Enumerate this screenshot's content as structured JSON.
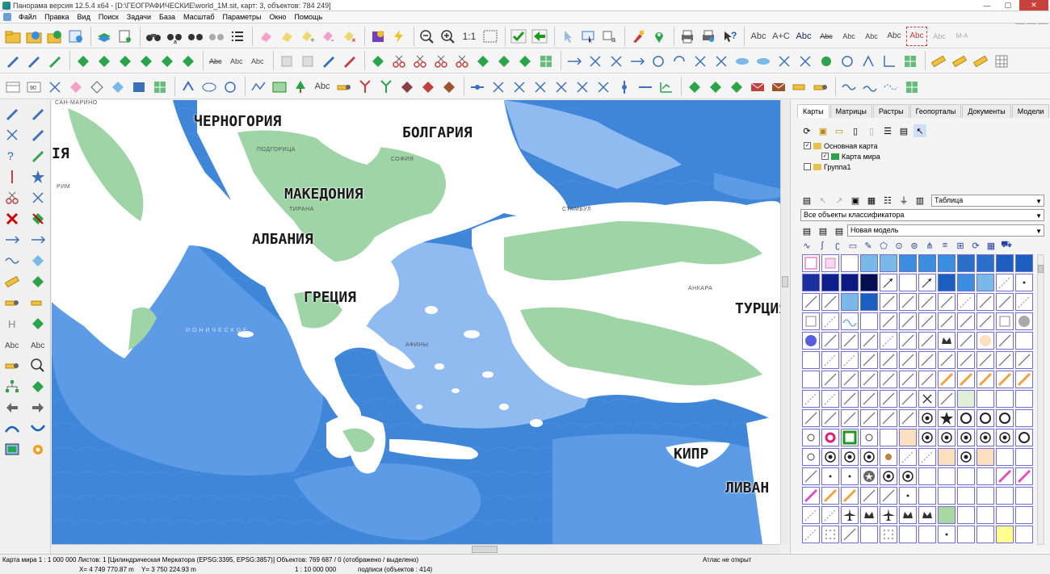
{
  "window": {
    "title": "Панорама версия 12.5.4 x64 - [D:\\ГЕОГРАФИЧЕСКИЕ\\world_1M.sit, карт: 3, объектов: 784 249]",
    "min_label": "—",
    "max_label": "▢",
    "close_label": "✕"
  },
  "menu": [
    "Файл",
    "Правка",
    "Вид",
    "Поиск",
    "Задачи",
    "База",
    "Масштаб",
    "Параметры",
    "Окно",
    "Помощь"
  ],
  "mdi_buttons": [
    "_",
    "▫",
    "×"
  ],
  "toolbar_text": {
    "scale_1_1": "1:1",
    "abc_labels": [
      "Abc",
      "A+C",
      "Abc",
      "Abc",
      "Abc",
      "Abc",
      "Abc",
      "Abc",
      "Abc",
      "M-A"
    ],
    "rotate_90": "90"
  },
  "map": {
    "labels": [
      {
        "text": "ЧЕРНОГОРИЯ",
        "name": "label-montenegro"
      },
      {
        "text": "БОЛГАРИЯ",
        "name": "label-bulgaria"
      },
      {
        "text": "МАКЕДОНИЯ",
        "name": "label-macedonia"
      },
      {
        "text": "АЛБАНИЯ",
        "name": "label-albania"
      },
      {
        "text": "ГРЕЦИЯ",
        "name": "label-greece"
      },
      {
        "text": "ТУРЦИЯ",
        "name": "label-turkey"
      },
      {
        "text": "КИПР",
        "name": "label-cyprus"
      },
      {
        "text": "ЛИВАН",
        "name": "label-lebanon"
      },
      {
        "text": "IЯ",
        "name": "label-italy-fragment"
      }
    ],
    "cities": [
      {
        "text": "САН-МАРИНО",
        "name": "city-san-marino"
      },
      {
        "text": "ПОДГОРИЦА",
        "name": "city-podgorica"
      },
      {
        "text": "СОФИЯ",
        "name": "city-sofia"
      },
      {
        "text": "РИМ",
        "name": "city-rome"
      },
      {
        "text": "ТИРАНА",
        "name": "city-tirana"
      },
      {
        "text": "СТАМБУЛ",
        "name": "city-istanbul"
      },
      {
        "text": "АНКАРА",
        "name": "city-ankara"
      },
      {
        "text": "АФИНЫ",
        "name": "city-athens"
      },
      {
        "text": "И О Н И Ч Е С К О Е",
        "name": "sea-ionian"
      }
    ]
  },
  "panel": {
    "tabs": [
      "Карты",
      "Матрицы",
      "Растры",
      "Геопорталы",
      "Документы",
      "Модели"
    ],
    "active_tab": "Карты",
    "tree": [
      {
        "label": "Основная карта",
        "checked": true
      },
      {
        "label": "Карта мира",
        "checked": true
      },
      {
        "label": "Группа1",
        "checked": false
      }
    ],
    "view_select": "Таблица",
    "classifier_select": "Все объекты классификатора",
    "model_select": "Новая модель"
  },
  "status": {
    "map_info": "Карта мира  1 : 1 000 000  Листов: 1   [Цилиндрическая Меркатора (EPSG:3395, EPSG:3857)]   Объектов: 769 687 / 0 (отображено / выделено)",
    "atlas": "Атлас не открыт",
    "coord_x": "X= 4 749 770.87 m",
    "coord_y": "Y= 3 750 224.93 m",
    "scale": "1 : 10 000 000",
    "labels_count": "подписи    (объектов : 414)"
  },
  "colors": {
    "sea_deep": "#3f86d9",
    "sea_mid": "#5d9be6",
    "sea_shallow": "#8fbbf0",
    "land_white": "#ffffff",
    "land_green": "#9ed4a6",
    "symbol_border": "#6f6fd4"
  }
}
